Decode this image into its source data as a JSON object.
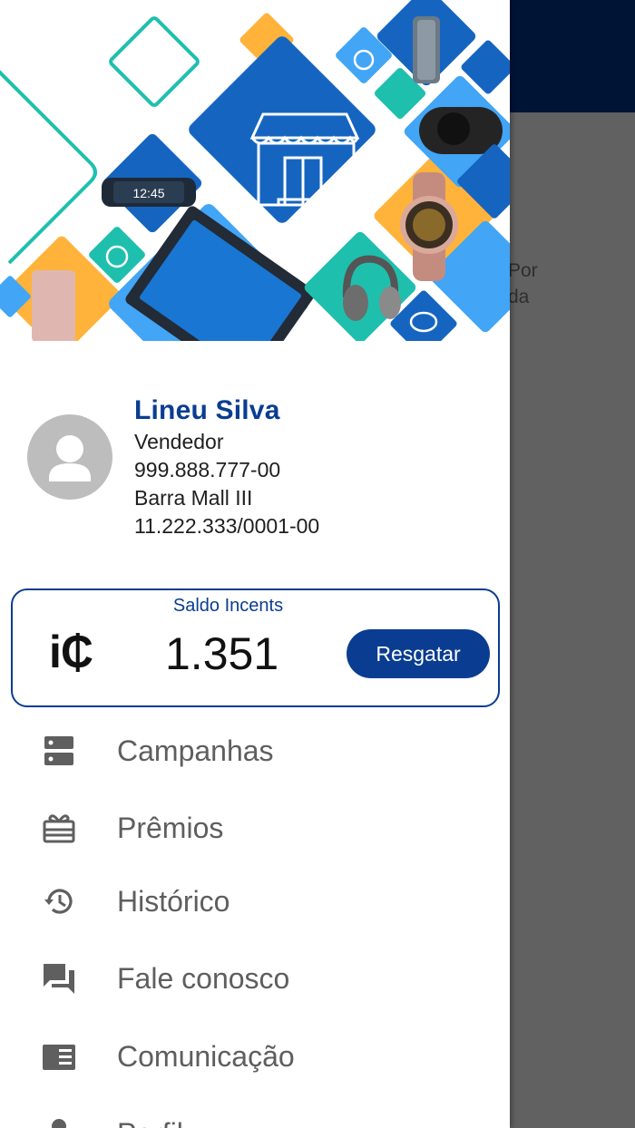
{
  "background": {
    "text_lines": [
      "Por",
      "da"
    ]
  },
  "profile": {
    "name": "Lineu Silva",
    "role": "Vendedor",
    "cpf": "999.888.777-00",
    "store": "Barra Mall III",
    "cnpj": "11.222.333/0001-00",
    "avatar_icon": "person-icon"
  },
  "balance": {
    "label": "Saldo Incents",
    "logo": "i₵",
    "value": "1.351",
    "redeem_label": "Resgatar"
  },
  "menu": [
    {
      "label": "Campanhas",
      "icon": "campaigns-icon"
    },
    {
      "label": "Prêmios",
      "icon": "gift-icon"
    },
    {
      "label": "Histórico",
      "icon": "history-icon"
    },
    {
      "label": "Fale conosco",
      "icon": "chat-icon"
    },
    {
      "label": "Comunicação",
      "icon": "newspaper-icon"
    },
    {
      "label": "Perfil",
      "icon": "person-icon"
    }
  ],
  "colors": {
    "primary": "#0a3d91",
    "topbar": "#001436",
    "overlay": "#616161",
    "banner_blue": "#1565c0",
    "banner_lightblue": "#42a5f5",
    "banner_teal": "#1fbfae",
    "banner_yellow": "#ffb33b"
  },
  "banner_watch_time": "12:45"
}
